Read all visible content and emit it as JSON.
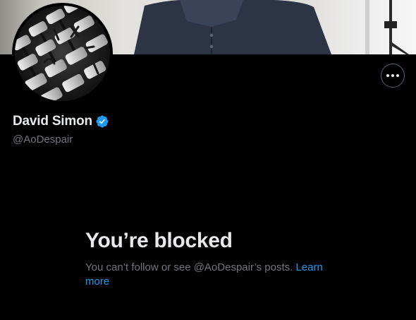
{
  "profile": {
    "display_name": "David Simon",
    "handle": "@AoDespair"
  },
  "blocked": {
    "title": "You’re blocked",
    "message": "You can’t follow or see @AoDespair’s posts.",
    "link_label": "Learn more"
  },
  "icons": {
    "more": "more-horizontal-icon",
    "verified": "verified-badge-icon"
  },
  "colors": {
    "background": "#000000",
    "primary_text": "#e7e9ea",
    "secondary_text": "#71767b",
    "accent": "#1d9bf0"
  }
}
